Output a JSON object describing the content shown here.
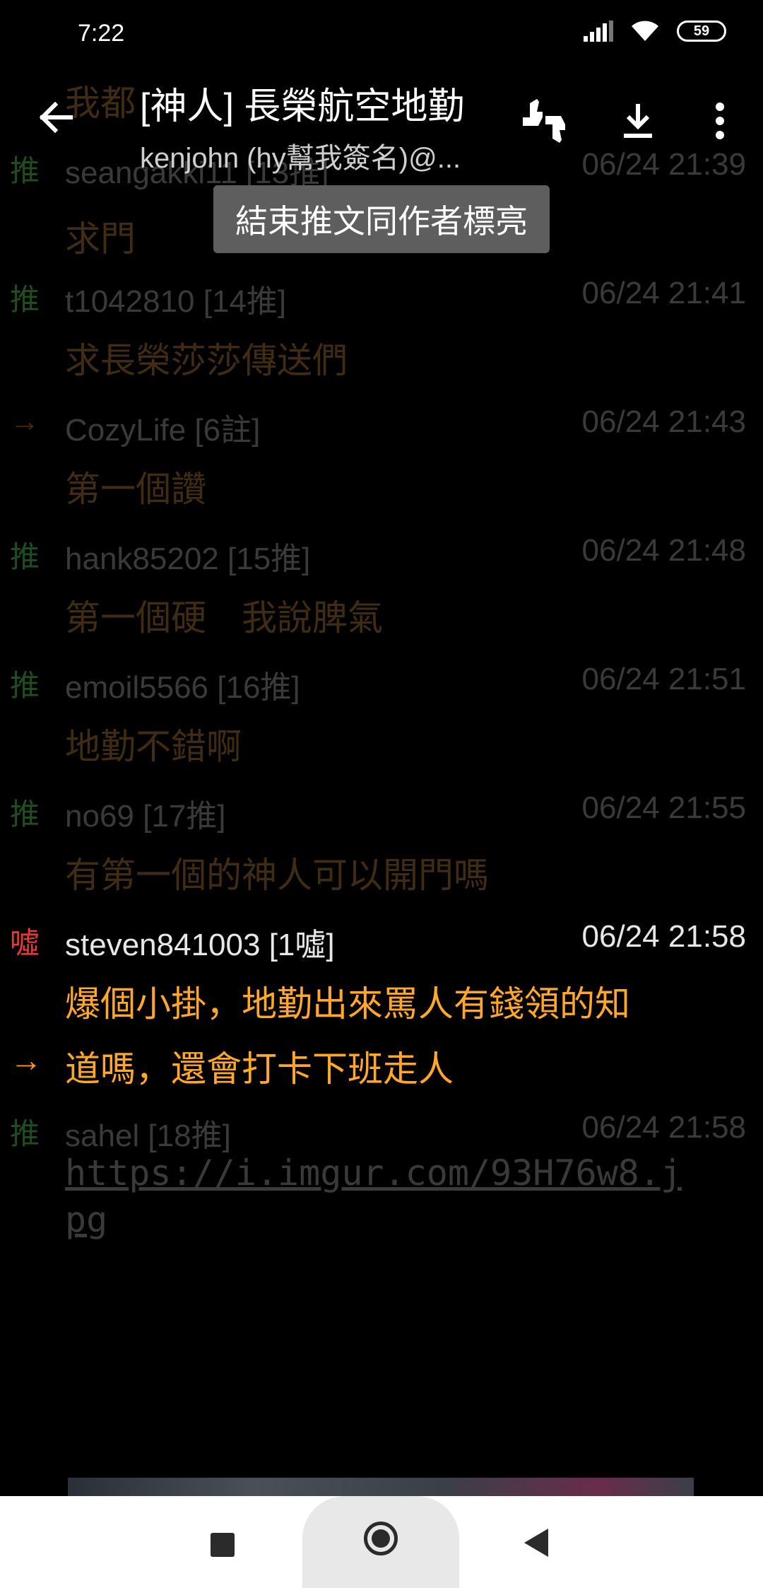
{
  "status": {
    "time": "7:22",
    "battery": "59"
  },
  "toolbar": {
    "title": "[神人] 長榮航空地勤",
    "subtitle": "kenjohn (hy幫我簽名)@..."
  },
  "tooltip": "結束推文同作者標亮",
  "comments": [
    {
      "tag": "",
      "user": "我都",
      "count": "",
      "time": "",
      "body": ""
    },
    {
      "tag": "推",
      "user": "seangakki11",
      "count": "[13推]",
      "time": "06/24 21:39",
      "body": "求門"
    },
    {
      "tag": "推",
      "user": "t1042810",
      "count": "[14推]",
      "time": "06/24 21:41",
      "body": "求長榮莎莎傳送們"
    },
    {
      "tag": "→",
      "user": "CozyLife",
      "count": "[6註]",
      "time": "06/24 21:43",
      "body": "第一個讚"
    },
    {
      "tag": "推",
      "user": "hank85202",
      "count": "[15推]",
      "time": "06/24 21:48",
      "body": "第一個硬　我說脾氣"
    },
    {
      "tag": "推",
      "user": "emoil5566",
      "count": "[16推]",
      "time": "06/24 21:51",
      "body": "地勤不錯啊"
    },
    {
      "tag": "推",
      "user": "no69",
      "count": "[17推]",
      "time": "06/24 21:55",
      "body": "有第一個的神人可以開門嗎"
    },
    {
      "tag": "噓",
      "user": "steven841003",
      "count": "[1噓]",
      "time": "06/24 21:58",
      "body": "爆個小掛，地勤出來罵人有錢領的知",
      "cont_tag": "→",
      "cont_body": "道嗎，還會打卡下班走人"
    },
    {
      "tag": "推",
      "user": "sahel",
      "count": "[18推]",
      "time": "06/24 21:58",
      "link": "https://i.imgur.com/93H76w8.jpg"
    }
  ]
}
